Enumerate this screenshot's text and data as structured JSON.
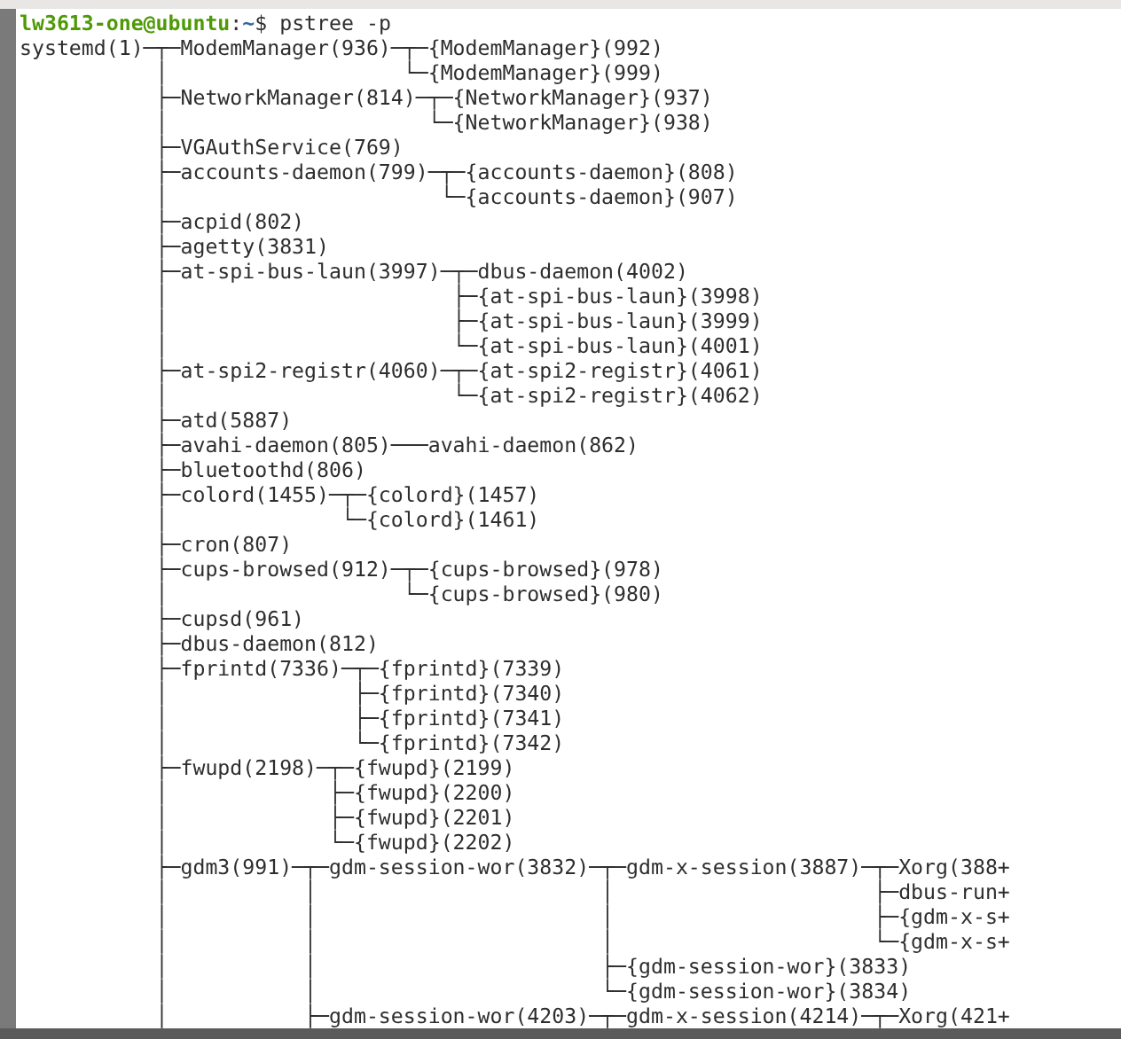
{
  "prompt": {
    "user_host": "lw3613-one@ubuntu",
    "separator": ":",
    "cwd": "~",
    "symbol": "$",
    "command": "pstree -p"
  },
  "output": [
    "systemd(1)─┬─ModemManager(936)─┬─{ModemManager}(992)",
    "           │                   └─{ModemManager}(999)",
    "           ├─NetworkManager(814)─┬─{NetworkManager}(937)",
    "           │                     └─{NetworkManager}(938)",
    "           ├─VGAuthService(769)",
    "           ├─accounts-daemon(799)─┬─{accounts-daemon}(808)",
    "           │                      └─{accounts-daemon}(907)",
    "           ├─acpid(802)",
    "           ├─agetty(3831)",
    "           ├─at-spi-bus-laun(3997)─┬─dbus-daemon(4002)",
    "           │                       ├─{at-spi-bus-laun}(3998)",
    "           │                       ├─{at-spi-bus-laun}(3999)",
    "           │                       └─{at-spi-bus-laun}(4001)",
    "           ├─at-spi2-registr(4060)─┬─{at-spi2-registr}(4061)",
    "           │                       └─{at-spi2-registr}(4062)",
    "           ├─atd(5887)",
    "           ├─avahi-daemon(805)───avahi-daemon(862)",
    "           ├─bluetoothd(806)",
    "           ├─colord(1455)─┬─{colord}(1457)",
    "           │              └─{colord}(1461)",
    "           ├─cron(807)",
    "           ├─cups-browsed(912)─┬─{cups-browsed}(978)",
    "           │                   └─{cups-browsed}(980)",
    "           ├─cupsd(961)",
    "           ├─dbus-daemon(812)",
    "           ├─fprintd(7336)─┬─{fprintd}(7339)",
    "           │               ├─{fprintd}(7340)",
    "           │               ├─{fprintd}(7341)",
    "           │               └─{fprintd}(7342)",
    "           ├─fwupd(2198)─┬─{fwupd}(2199)",
    "           │             ├─{fwupd}(2200)",
    "           │             ├─{fwupd}(2201)",
    "           │             └─{fwupd}(2202)",
    "           ├─gdm3(991)─┬─gdm-session-wor(3832)─┬─gdm-x-session(3887)─┬─Xorg(388+",
    "           │           │                       │                     ├─dbus-run+",
    "           │           │                       │                     ├─{gdm-x-s+",
    "           │           │                       │                     └─{gdm-x-s+",
    "           │           │                       ├─{gdm-session-wor}(3833)",
    "           │           │                       └─{gdm-session-wor}(3834)",
    "           │           ├─gdm-session-wor(4203)─┬─gdm-x-session(4214)─┬─Xorg(421+"
  ]
}
